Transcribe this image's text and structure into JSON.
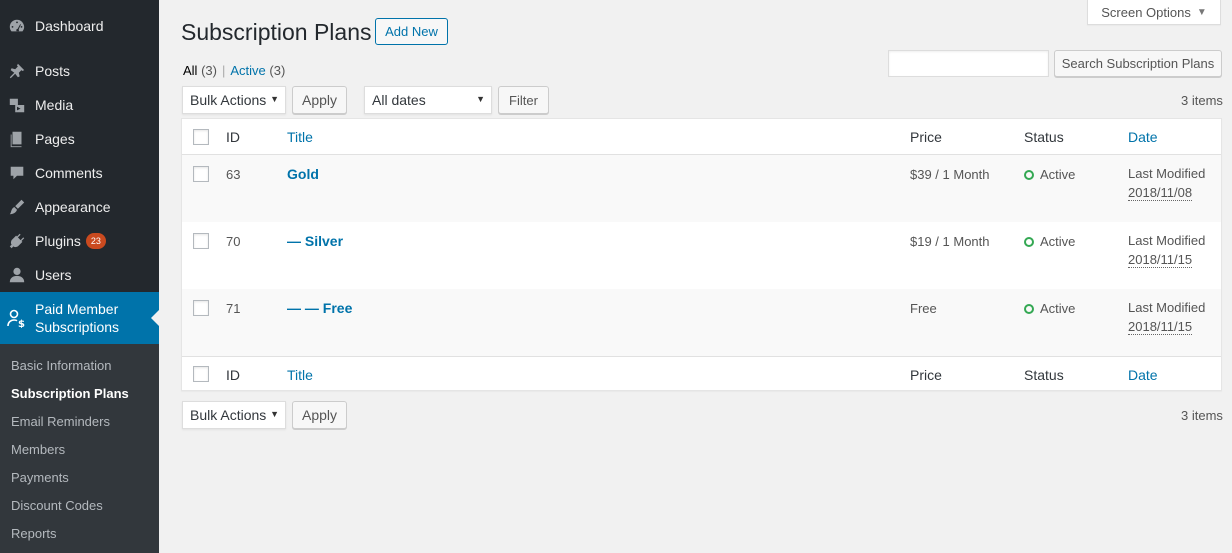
{
  "sidebar": {
    "items": [
      {
        "label": "Dashboard",
        "icon": "dashboard-icon"
      },
      {
        "label": "Posts",
        "icon": "pin-icon"
      },
      {
        "label": "Media",
        "icon": "media-icon"
      },
      {
        "label": "Pages",
        "icon": "pages-icon"
      },
      {
        "label": "Comments",
        "icon": "comment-icon"
      },
      {
        "label": "Appearance",
        "icon": "brush-icon"
      },
      {
        "label": "Plugins",
        "icon": "plugin-icon",
        "badge": "23"
      },
      {
        "label": "Users",
        "icon": "user-icon"
      }
    ],
    "active": {
      "line1": "Paid Member",
      "line2": "Subscriptions",
      "icon": "member-dollar-icon"
    },
    "submenu": [
      "Basic Information",
      "Subscription Plans",
      "Email Reminders",
      "Members",
      "Payments",
      "Discount Codes",
      "Reports"
    ]
  },
  "header": {
    "title": "Subscription Plans",
    "add_new": "Add New",
    "screen_options": "Screen Options"
  },
  "views": {
    "all_label": "All",
    "all_count": "(3)",
    "active_label": "Active",
    "active_count": "(3)",
    "separator": "|"
  },
  "search": {
    "button": "Search Subscription Plans",
    "placeholder": ""
  },
  "toolbar": {
    "bulk_actions": "Bulk Actions",
    "apply": "Apply",
    "all_dates": "All dates",
    "filter": "Filter",
    "items_count": "3 items"
  },
  "table": {
    "columns": {
      "id": "ID",
      "title": "Title",
      "price": "Price",
      "status": "Status",
      "date": "Date"
    },
    "rows": [
      {
        "id": "63",
        "title": "Gold",
        "price": "$39 / 1 Month",
        "status": "Active",
        "date_label": "Last Modified",
        "date": "2018/11/08"
      },
      {
        "id": "70",
        "title": "— Silver",
        "price": "$19 / 1 Month",
        "status": "Active",
        "date_label": "Last Modified",
        "date": "2018/11/15"
      },
      {
        "id": "71",
        "title": "— — Free",
        "price": "Free",
        "status": "Active",
        "date_label": "Last Modified",
        "date": "2018/11/15"
      }
    ]
  },
  "colors": {
    "sidebar_bg": "#23282d",
    "accent": "#0073aa",
    "status_active": "#34a853",
    "badge": "#ca4a1f"
  }
}
